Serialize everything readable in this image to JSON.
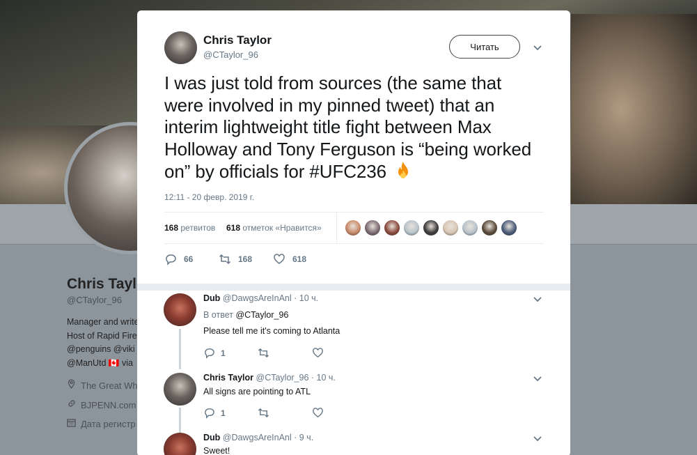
{
  "background_profile": {
    "name": "Chris Tayl",
    "handle": "@CTaylor_96",
    "bio_lines": [
      "Manager and write",
      "Host of Rapid Fire",
      "@penguins @viki",
      "@ManUtd 🇨🇦 via"
    ],
    "location": "The Great Wh",
    "website": "BJPENN.com",
    "joined": "Дата регистр",
    "location_icon": "location-pin-icon",
    "link_icon": "link-icon",
    "calendar_icon": "calendar-icon"
  },
  "tweet": {
    "author_name": "Chris Taylor",
    "author_handle": "@CTaylor_96",
    "follow_label": "Читать",
    "text": "I was just told from sources (the same that were involved in my pinned tweet) that an interim lightweight title fight between Max Holloway and Tony Ferguson is “being worked on” by officials for ",
    "hashtag": "#UFC236",
    "emoji": "fire-emoji",
    "timestamp": "12:11 - 20 февр. 2019 г.",
    "retweets_count": "168",
    "retweets_label": "ретвитов",
    "likes_count": "618",
    "likes_label": "отметок «Нравится»",
    "liker_avatar_colors": [
      "#c98a6a",
      "#7d6a74",
      "#8a4a3c",
      "#b8c4cc",
      "#3c3a3a",
      "#d8c6b4",
      "#b8c4cc",
      "#5a4a3a",
      "#4a5a78"
    ],
    "actions": {
      "reply_count": "66",
      "retweet_count": "168",
      "like_count": "618"
    }
  },
  "replies": [
    {
      "name": "Dub",
      "handle": "@DawgsAreInAnl",
      "time": "· 10 ч.",
      "reply_to_prefix": "В ответ",
      "reply_to_handle": "@CTaylor_96",
      "text": "Please tell me it's coming to Atlanta",
      "reply_count": "1"
    },
    {
      "name": "Chris Taylor",
      "handle": "@CTaylor_96",
      "time": "· 10 ч.",
      "text": "All signs are pointing to ATL",
      "reply_count": "1"
    },
    {
      "name": "Dub",
      "handle": "@DawgsAreInAnl",
      "time": "· 9 ч.",
      "text": "Sweet!"
    }
  ],
  "colors": {
    "text_primary": "#14171a",
    "text_secondary": "#657786",
    "divider": "#e6ecf0",
    "modal_bg": "#ffffff"
  }
}
